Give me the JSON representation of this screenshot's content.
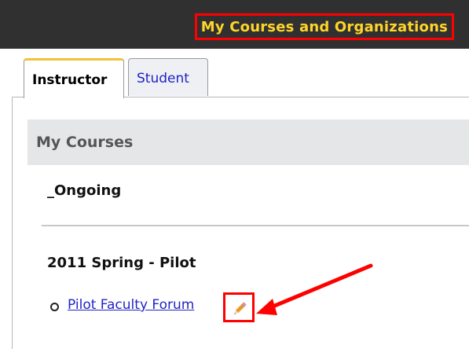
{
  "header": {
    "title": "My Courses and Organizations"
  },
  "tabs": [
    {
      "label": "Instructor",
      "active": true
    },
    {
      "label": "Student",
      "active": false
    }
  ],
  "section": {
    "title": "My Courses"
  },
  "terms": [
    {
      "label": "_Ongoing",
      "courses": []
    },
    {
      "label": "2011 Spring - Pilot",
      "courses": [
        {
          "label": "Pilot Faculty Forum"
        }
      ]
    }
  ],
  "icons": {
    "edit": "pencil-icon",
    "annotation": "red-arrow"
  },
  "colors": {
    "topbar": "#303030",
    "title_text": "#ffd52a",
    "highlight": "#ff0000",
    "link": "#2323c8",
    "section_bg": "#e5e6e8",
    "active_tab_accent": "#f3c13a"
  }
}
